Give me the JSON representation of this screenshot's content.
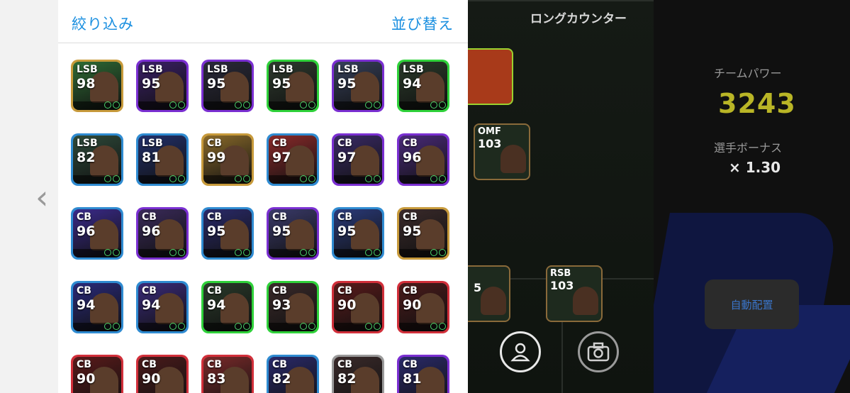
{
  "panel": {
    "filter_label": "絞り込み",
    "sort_label": "並び替え",
    "cards": [
      {
        "pos": "LSB",
        "rating": "98",
        "border": "#c79a3b",
        "bg": "#2f6b35"
      },
      {
        "pos": "LSB",
        "rating": "95",
        "border": "#7a2fd1",
        "bg": "#3a1f66"
      },
      {
        "pos": "LSB",
        "rating": "95",
        "border": "#7a2fd1",
        "bg": "#2a2a3a"
      },
      {
        "pos": "LSB",
        "rating": "95",
        "border": "#2fd13a",
        "bg": "#2e3a2e"
      },
      {
        "pos": "LSB",
        "rating": "95",
        "border": "#7a2fd1",
        "bg": "#36405a"
      },
      {
        "pos": "LSB",
        "rating": "94",
        "border": "#2fd13a",
        "bg": "#2a3a2a"
      },
      {
        "pos": "LSB",
        "rating": "82",
        "border": "#2f8bd1",
        "bg": "#2e4a3a"
      },
      {
        "pos": "LSB",
        "rating": "81",
        "border": "#2f8bd1",
        "bg": "#22306a"
      },
      {
        "pos": "CB",
        "rating": "99",
        "border": "#c79a3b",
        "bg": "#8a6a2a"
      },
      {
        "pos": "CB",
        "rating": "97",
        "border": "#2f8bd1",
        "bg": "#8a2a2a"
      },
      {
        "pos": "CB",
        "rating": "97",
        "border": "#7a2fd1",
        "bg": "#3a2a66"
      },
      {
        "pos": "CB",
        "rating": "96",
        "border": "#7a2fd1",
        "bg": "#4a2a7a"
      },
      {
        "pos": "CB",
        "rating": "96",
        "border": "#2f8bd1",
        "bg": "#3a2a8a"
      },
      {
        "pos": "CB",
        "rating": "96",
        "border": "#7a2fd1",
        "bg": "#3a2a5a"
      },
      {
        "pos": "CB",
        "rating": "95",
        "border": "#2f8bd1",
        "bg": "#2a2a6a"
      },
      {
        "pos": "CB",
        "rating": "95",
        "border": "#7a2fd1",
        "bg": "#3a3a6a"
      },
      {
        "pos": "CB",
        "rating": "95",
        "border": "#2f8bd1",
        "bg": "#2a3a7a"
      },
      {
        "pos": "CB",
        "rating": "95",
        "border": "#c79a3b",
        "bg": "#3a2a2a"
      },
      {
        "pos": "CB",
        "rating": "94",
        "border": "#2f8bd1",
        "bg": "#2a2a7a"
      },
      {
        "pos": "CB",
        "rating": "94",
        "border": "#2f8bd1",
        "bg": "#3a2a7a"
      },
      {
        "pos": "CB",
        "rating": "94",
        "border": "#2fd13a",
        "bg": "#2a3a2a"
      },
      {
        "pos": "CB",
        "rating": "93",
        "border": "#2fd13a",
        "bg": "#3a2a2a"
      },
      {
        "pos": "CB",
        "rating": "90",
        "border": "#d12f3a",
        "bg": "#5a1a1a"
      },
      {
        "pos": "CB",
        "rating": "90",
        "border": "#d12f3a",
        "bg": "#4a1a1a"
      },
      {
        "pos": "CB",
        "rating": "90",
        "border": "#d12f3a",
        "bg": "#5a1a1a"
      },
      {
        "pos": "CB",
        "rating": "90",
        "border": "#d12f3a",
        "bg": "#4a1a1a"
      },
      {
        "pos": "CB",
        "rating": "83",
        "border": "#d12f3a",
        "bg": "#7a2a2a"
      },
      {
        "pos": "CB",
        "rating": "82",
        "border": "#2f8bd1",
        "bg": "#2a2a6a"
      },
      {
        "pos": "CB",
        "rating": "82",
        "border": "#9a9a9a",
        "bg": "#3a2a2a"
      },
      {
        "pos": "CB",
        "rating": "81",
        "border": "#7a2fd1",
        "bg": "#2a2a6a"
      }
    ]
  },
  "formation": {
    "title": "ロングカウンター",
    "players": [
      {
        "pos": "OMF",
        "rating": "103"
      },
      {
        "pos": "RSB",
        "rating": "103"
      },
      {
        "pos": "",
        "rating": "5"
      }
    ]
  },
  "team": {
    "power_label": "チームパワー",
    "power_value": "3243",
    "bonus_label": "選手ボーナス",
    "bonus_value": "× 1.30",
    "auto_assign_label": "自動配置"
  },
  "icons": {
    "prev": "chevron-left-icon",
    "player": "person-icon",
    "camera": "camera-icon"
  }
}
